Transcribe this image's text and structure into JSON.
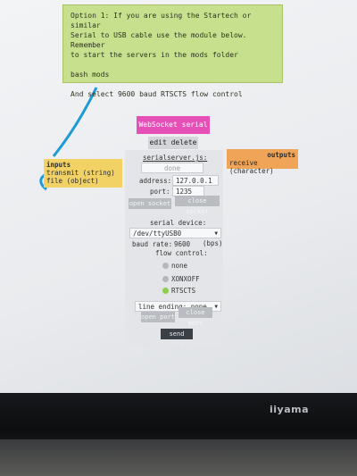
{
  "note": {
    "line1": "Option 1: If you are using the Startech or similar",
    "line2": "Serial to USB cable use the module below. Remember",
    "line3": "to start the servers in the mods folder",
    "line4": "bash mods",
    "line5": "And select 9600 baud RTSCTS flow control"
  },
  "node": {
    "title": "WebSocket serial",
    "edit": "edit",
    "delete": "delete",
    "section_label": "serialserver.js:",
    "done": "done",
    "address_label": "address:",
    "address_value": "127.0.0.1",
    "port_label": "port:",
    "port_value": "1235",
    "open_socket": "open socket",
    "close_socket": "close socket",
    "serial_device_label": "serial device:",
    "serial_device_value": "/dev/ttyUSB0",
    "baud_label": "baud rate:",
    "baud_value": "9600",
    "baud_unit": "(bps)",
    "flow_label": "flow control:",
    "flow_options": [
      "none",
      "XONXOFF",
      "RTSCTS"
    ],
    "flow_selected": "RTSCTS",
    "line_ending": "line ending: none",
    "open_port": "open port",
    "close_port": "close port",
    "send_file": "send file"
  },
  "inputs": {
    "header": "inputs",
    "items": [
      "transmit (string)",
      "file (object)"
    ]
  },
  "outputs": {
    "header": "outputs",
    "items": [
      "receive (character)"
    ]
  },
  "monitor": {
    "brand": "iiyama"
  },
  "colors": {
    "note_bg": "#c7e08e",
    "title_bg": "#e54fb7",
    "inputs_bg": "#f2d265",
    "outputs_bg": "#f0a457",
    "wire": "#1e9ad6",
    "radio_on": "#8ccf4f"
  }
}
